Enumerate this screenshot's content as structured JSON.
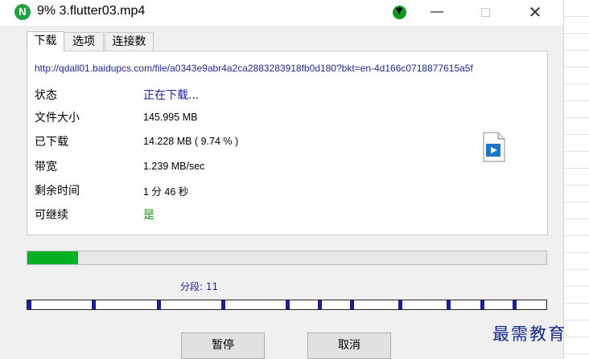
{
  "window": {
    "app_icon_letter": "N",
    "title": "9%  3.flutter03.mp4",
    "controls": {
      "minimize": "—",
      "close": "✕"
    }
  },
  "tabs": [
    "下载",
    "选项",
    "连接数"
  ],
  "info": {
    "url": "http://qdall01.baidupcs.com/file/a0343e9abr4a2ca2883283918fb0d180?bkt=en-4d166c0718877615a5f",
    "rows": [
      {
        "label": "状态",
        "value": "正在下载..."
      },
      {
        "label": "文件大小",
        "value": "145.995  MB"
      },
      {
        "label": "已下载",
        "value": "14.228  MB  ( 9.74 % )"
      },
      {
        "label": "带宽",
        "value": "1.239  MB/sec"
      },
      {
        "label": "剩余时间",
        "value": "1 分  46 秒"
      },
      {
        "label": "可继续",
        "value": "是"
      }
    ]
  },
  "progress": {
    "fraction": 0.0974,
    "color": "#06b025"
  },
  "segments": {
    "label": "分段: 11",
    "count": 11
  },
  "buttons": {
    "pause": "暂停",
    "cancel": "取消"
  },
  "watermark": "最需教育"
}
